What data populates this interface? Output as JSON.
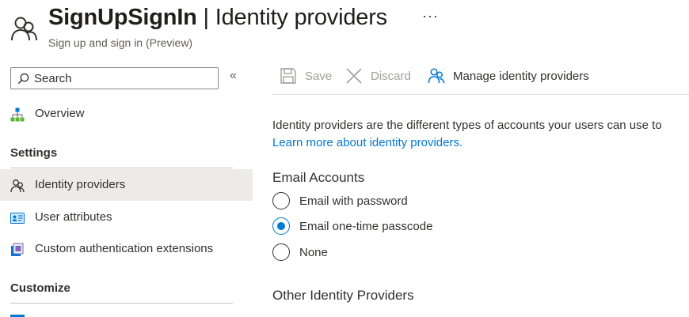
{
  "header": {
    "title_bold": "SignUpSignIn",
    "title_rest": " | Identity providers",
    "subtitle": "Sign up and sign in (Preview)",
    "more": "···"
  },
  "sidebar": {
    "search_placeholder": "Search",
    "collapse_glyph": "«",
    "items": [
      {
        "label": "Overview",
        "icon": "sitemap-icon"
      },
      {
        "label": "Identity providers",
        "icon": "users-icon",
        "selected": true
      },
      {
        "label": "User attributes",
        "icon": "id-card-icon"
      },
      {
        "label": "Custom authentication extensions",
        "icon": "extension-icon"
      }
    ],
    "sections": [
      "Settings",
      "Customize"
    ]
  },
  "toolbar": {
    "save_label": "Save",
    "discard_label": "Discard",
    "manage_label": "Manage identity providers"
  },
  "content": {
    "description": "Identity providers are the different types of accounts your users can use to",
    "learn_more": "Learn more about identity providers.",
    "email_heading": "Email Accounts",
    "email_options": [
      {
        "label": "Email with password",
        "checked": false
      },
      {
        "label": "Email one-time passcode",
        "checked": true
      },
      {
        "label": "None",
        "checked": false
      }
    ],
    "other_heading": "Other Identity Providers"
  },
  "colors": {
    "accent": "#0078d4",
    "selected_bg": "#edebe9",
    "disabled_text": "#a19f9d"
  }
}
